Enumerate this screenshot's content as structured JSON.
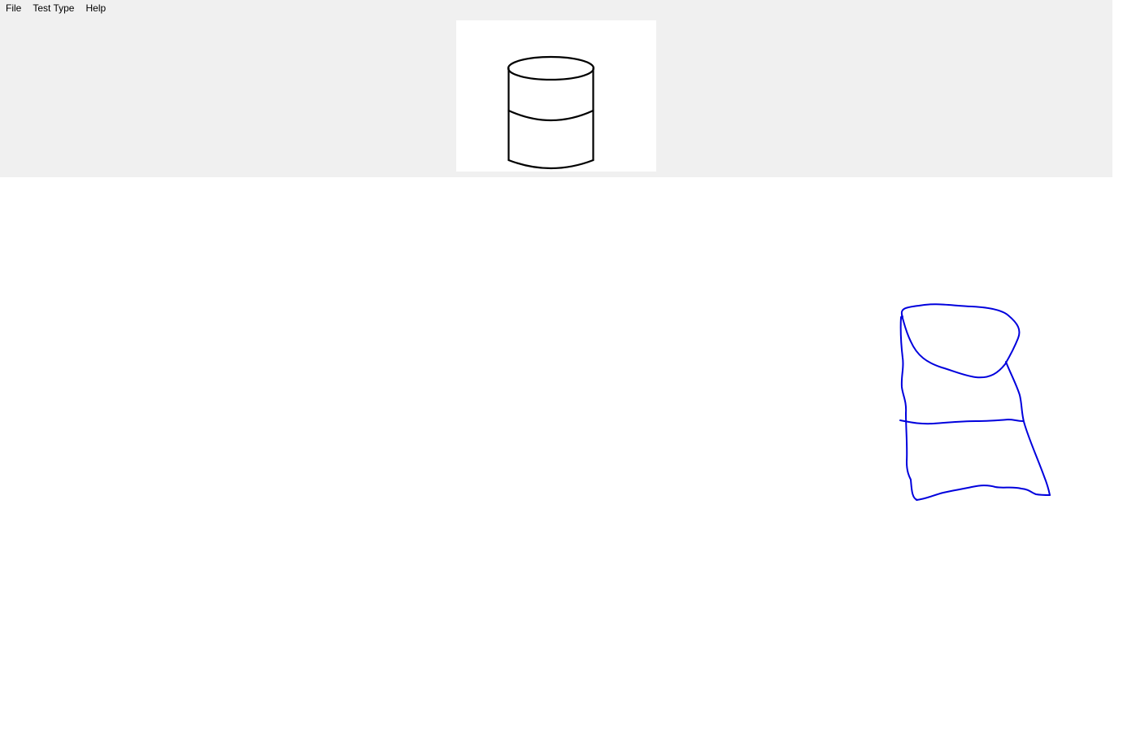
{
  "menu": {
    "items": [
      {
        "label": "File"
      },
      {
        "label": "Test Type"
      },
      {
        "label": "Help"
      }
    ]
  },
  "reference_shape": {
    "icon": "cylinder-icon",
    "stroke_color": "#000000"
  },
  "user_sketch": {
    "stroke_color": "#0000dd"
  },
  "colors": {
    "panel_background": "#f0f0f0",
    "canvas_background": "#ffffff"
  }
}
